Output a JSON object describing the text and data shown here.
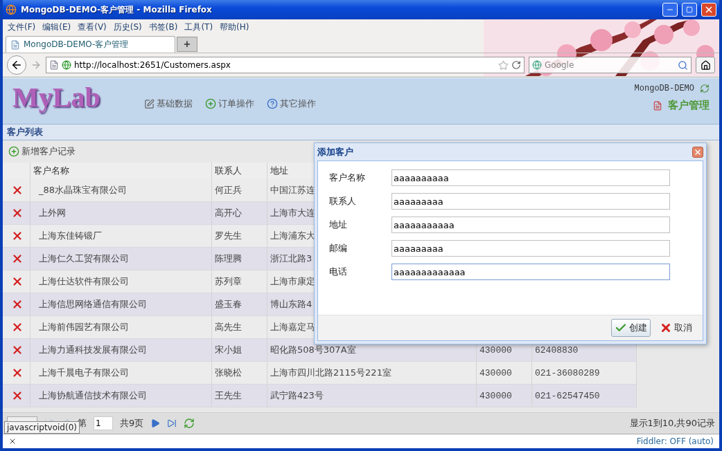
{
  "window": {
    "title": "MongoDB-DEMO-客户管理 - Mozilla Firefox"
  },
  "menu": [
    "文件(F)",
    "编辑(E)",
    "查看(V)",
    "历史(S)",
    "书签(B)",
    "工具(T)",
    "帮助(H)"
  ],
  "tabs": [
    {
      "label": "MongoDB-DEMO-客户管理",
      "selected": true
    }
  ],
  "new_tab": "+",
  "address_bar": {
    "url": "http://localhost:2651/Customers.aspx"
  },
  "search": {
    "placeholder": "Google"
  },
  "header": {
    "logo": "MyLab",
    "nav": [
      "基础数据",
      "订单操作",
      "其它操作"
    ],
    "site_name": "MongoDB-DEMO",
    "page_title": "客户管理"
  },
  "section_title": "客户列表",
  "toolbar": {
    "add_label": "新增客户记录"
  },
  "table": {
    "columns": [
      "客户名称",
      "联系人",
      "地址"
    ],
    "rows": [
      {
        "name": "_88水晶珠宝有限公司",
        "contact": "何正兵",
        "address": "中国江苏连"
      },
      {
        "name": "上外网",
        "contact": "高开心",
        "address": "上海市大连"
      },
      {
        "name": "上海东佳铸锻厂",
        "contact": "罗先生",
        "address": "上海浦东大"
      },
      {
        "name": "上海仁久工贸有限公司",
        "contact": "陈理腾",
        "address": "浙江北路3"
      },
      {
        "name": "上海仕达软件有限公司",
        "contact": "苏列章",
        "address": "上海市康定"
      },
      {
        "name": "上海信思网络通信有限公司",
        "contact": "盛玉春",
        "address": "博山东路4"
      },
      {
        "name": "上海前伟园艺有限公司",
        "contact": "高先生",
        "address": "上海嘉定马"
      },
      {
        "name": "上海力通科技发展有限公司",
        "contact": "宋小姐",
        "address": "昭化路508号307A室",
        "postcode": "430000",
        "phone": "62408830"
      },
      {
        "name": "上海千晨电子有限公司",
        "contact": "张晓松",
        "address": "上海市四川北路2115号221室",
        "postcode": "430000",
        "phone": "021-36080289"
      },
      {
        "name": "上海协航通信技术有限公司",
        "contact": "王先生",
        "address": "武宁路423号",
        "postcode": "430000",
        "phone": "021-62547450"
      }
    ]
  },
  "pager": {
    "first_disabled": true,
    "prev_disabled": true,
    "page_prefix": "第",
    "page": "1",
    "total": "共9页",
    "info": "显示1到10,共90记录"
  },
  "link_tooltip": "javascriptvoid(0)",
  "dialog": {
    "title": "添加客户",
    "fields": [
      {
        "label": "客户名称",
        "value": "aaaaaaaaaa",
        "focused": false
      },
      {
        "label": "联系人",
        "value": "aaaaaaaaa",
        "focused": false
      },
      {
        "label": "地址",
        "value": "aaaaaaaaaaa",
        "focused": false
      },
      {
        "label": "邮编",
        "value": "aaaaaaaaa",
        "focused": false
      },
      {
        "label": "电话",
        "value": "aaaaaaaaaaaaa",
        "focused": true
      }
    ],
    "buttons": [
      {
        "label": "创建",
        "kind": "confirm"
      },
      {
        "label": "取消",
        "kind": "cancel"
      }
    ]
  },
  "status_bar": {
    "fiddler": "Fiddler: OFF (auto)"
  }
}
